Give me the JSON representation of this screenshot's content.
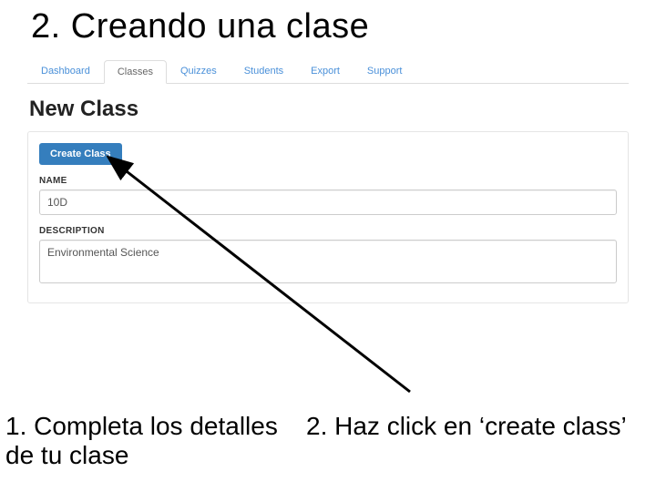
{
  "slide": {
    "title": "2. Creando una clase"
  },
  "tabs": {
    "t0": "Dashboard",
    "t1": "Classes",
    "t2": "Quizzes",
    "t3": "Students",
    "t4": "Export",
    "t5": "Support"
  },
  "form": {
    "heading": "New Class",
    "create_label": "Create Class",
    "name_label": "NAME",
    "name_value": "10D",
    "desc_label": "DESCRIPTION",
    "desc_value": "Environmental Science"
  },
  "captions": {
    "left": "1. Completa los detalles de tu clase",
    "right": "2. Haz click en  ‘create class’"
  }
}
